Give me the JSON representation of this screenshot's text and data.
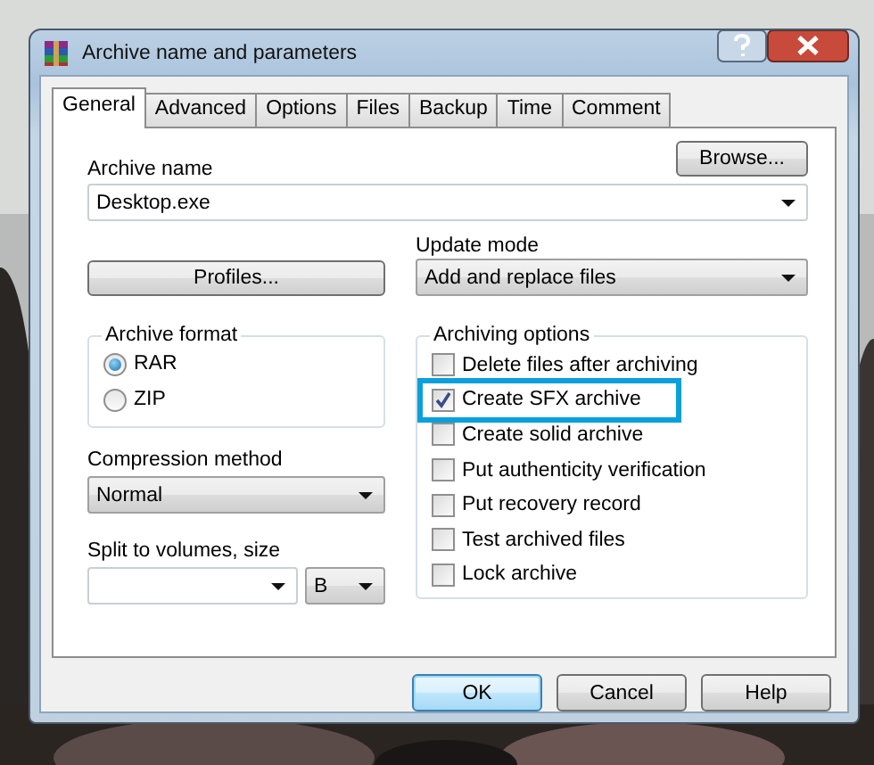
{
  "window": {
    "title": "Archive name and parameters"
  },
  "tabs": [
    {
      "label": "General",
      "selected": true
    },
    {
      "label": "Advanced",
      "selected": false
    },
    {
      "label": "Options",
      "selected": false
    },
    {
      "label": "Files",
      "selected": false
    },
    {
      "label": "Backup",
      "selected": false
    },
    {
      "label": "Time",
      "selected": false
    },
    {
      "label": "Comment",
      "selected": false
    }
  ],
  "archive_name": {
    "label": "Archive name",
    "value": "Desktop.exe",
    "browse_button": "Browse..."
  },
  "profiles_button": "Profiles...",
  "update_mode": {
    "label": "Update mode",
    "value": "Add and replace files"
  },
  "archive_format": {
    "label": "Archive format",
    "options": [
      {
        "label": "RAR",
        "selected": true
      },
      {
        "label": "ZIP",
        "selected": false
      }
    ]
  },
  "compression_method": {
    "label": "Compression method",
    "value": "Normal"
  },
  "split_volumes": {
    "label": "Split to volumes, size",
    "unit": "B"
  },
  "archiving_options": {
    "label": "Archiving options",
    "options": [
      {
        "label": "Delete files after archiving",
        "checked": false,
        "highlighted": false
      },
      {
        "label": "Create SFX archive",
        "checked": true,
        "highlighted": true
      },
      {
        "label": "Create solid archive",
        "checked": false,
        "highlighted": false
      },
      {
        "label": "Put authenticity verification",
        "checked": false,
        "highlighted": false
      },
      {
        "label": "Put recovery record",
        "checked": false,
        "highlighted": false
      },
      {
        "label": "Test archived files",
        "checked": false,
        "highlighted": false
      },
      {
        "label": "Lock archive",
        "checked": false,
        "highlighted": false
      }
    ]
  },
  "buttons": [
    {
      "label": "OK",
      "default": true
    },
    {
      "label": "Cancel",
      "default": false
    },
    {
      "label": "Help",
      "default": false
    }
  ]
}
